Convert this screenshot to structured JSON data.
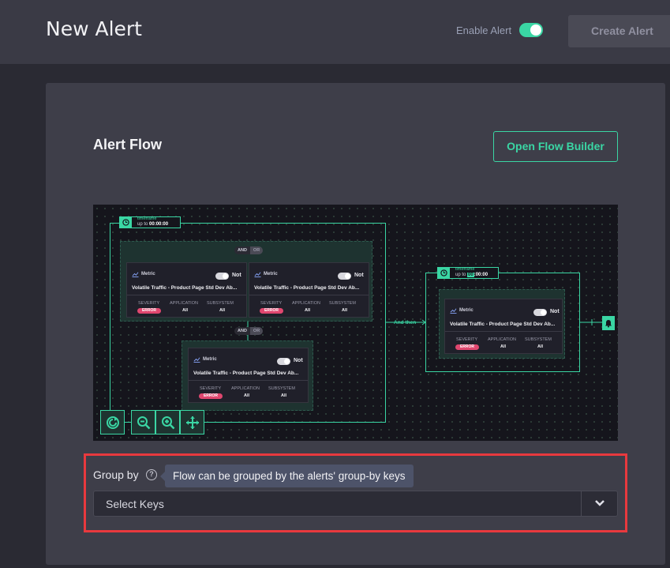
{
  "header": {
    "title": "New Alert",
    "enable_label": "Enable Alert",
    "enable_on": true,
    "create_label": "Create Alert"
  },
  "alert_flow": {
    "title": "Alert Flow",
    "open_builder_label": "Open Flow Builder",
    "timeframe_1": {
      "label": "timeframe",
      "prefix": "up to",
      "value": "00:00:00"
    },
    "timeframe_2": {
      "label": "timeframe",
      "prefix": "up to",
      "value_hl": "00",
      "value_rest": ":00:00"
    },
    "and_label": "AND",
    "or_label": "OR",
    "and_then_label": "And then",
    "columns": {
      "severity": "SEVERITY",
      "application": "APPLICATION",
      "subsystem": "SUBSYSTEM"
    },
    "cards": [
      {
        "metric": "Metric",
        "not": "Not",
        "name": "Volatile Traffic - Product Page Std Dev Ab...",
        "severity": "ERROR",
        "application": "All",
        "subsystem": "All"
      },
      {
        "metric": "Metric",
        "not": "Not",
        "name": "Volatile Traffic - Product Page Std Dev Ab...",
        "severity": "ERROR",
        "application": "All",
        "subsystem": "All"
      },
      {
        "metric": "Metric",
        "not": "Not",
        "name": "Volatile Traffic - Product Page Std Dev Ab...",
        "severity": "ERROR",
        "application": "All",
        "subsystem": "All"
      },
      {
        "metric": "Metric",
        "not": "Not",
        "name": "Volatile Traffic - Product Page Std Dev Ab...",
        "severity": "ERROR",
        "application": "All",
        "subsystem": "All"
      }
    ],
    "tools": [
      "reset-icon",
      "zoom-out-icon",
      "zoom-in-icon",
      "move-icon"
    ]
  },
  "group_by": {
    "label": "Group by",
    "tooltip": "Flow can be grouped by the alerts' group-by keys",
    "placeholder": "Select Keys"
  },
  "colors": {
    "accent": "#3ad6a4",
    "error": "#e0476f",
    "highlight": "#e8393e"
  }
}
